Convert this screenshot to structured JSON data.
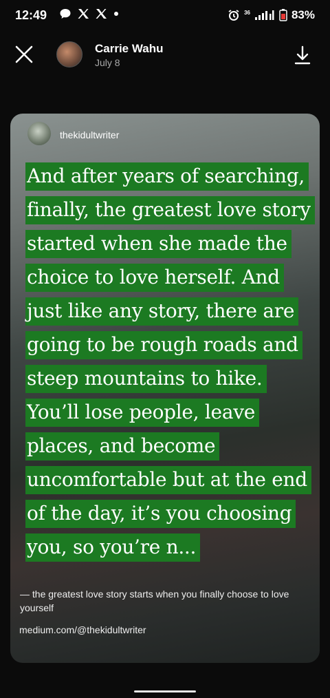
{
  "status_bar": {
    "time": "12:49",
    "battery": "83%",
    "network": "36"
  },
  "header": {
    "author_name": "Carrie Wahu",
    "date": "July 8"
  },
  "story": {
    "handle": "thekidultwriter",
    "quote": "And after years of searching, finally, the greatest love story started when she made the choice to love herself. And just like any story, there are going to be rough roads and steep mountains to hike. You’ll lose people, leave places, and become uncomfortable but at the end of the day, it’s you choosing you, so you’re n...",
    "caption": "— the greatest love story starts when you finally choose to love yourself",
    "source": "medium.com/@thekidultwriter",
    "highlight_color": "#1c7a22"
  }
}
